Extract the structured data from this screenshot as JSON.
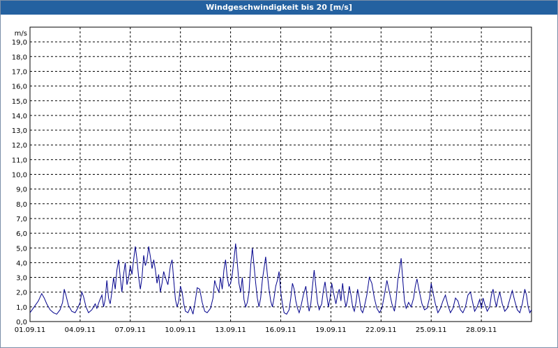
{
  "window": {
    "title": "Windgeschwindigkeit bis 20 [m/s]"
  },
  "chart_data": {
    "type": "line",
    "title": "Windgeschwindigkeit bis 20 [m/s]",
    "ylabel": "m/s",
    "xlabel": "",
    "ylim": [
      0,
      20
    ],
    "xlim": [
      "01.09.11",
      "01.10.11"
    ],
    "grid": true,
    "colors": {
      "line": "#00008b",
      "grid": "#000000",
      "frame": "#000000",
      "titlebar": "#2461a0"
    },
    "y_ticks": [
      "0,0",
      "1,0",
      "2,0",
      "3,0",
      "4,0",
      "5,0",
      "6,0",
      "7,0",
      "8,0",
      "9,0",
      "10,0",
      "11,0",
      "12,0",
      "13,0",
      "14,0",
      "15,0",
      "16,0",
      "17,0",
      "18,0",
      "19,0"
    ],
    "x_ticks": [
      "01.09.11",
      "04.09.11",
      "07.09.11",
      "10.09.11",
      "13.09.11",
      "16.09.11",
      "19.09.11",
      "22.09.11",
      "25.09.11",
      "28.09.11"
    ],
    "series": [
      {
        "values": [
          [
            0.0,
            0.6
          ],
          [
            0.25,
            1.0
          ],
          [
            0.5,
            1.4
          ],
          [
            0.7,
            1.9
          ],
          [
            0.85,
            1.6
          ],
          [
            1.0,
            1.2
          ],
          [
            1.2,
            0.8
          ],
          [
            1.4,
            0.6
          ],
          [
            1.6,
            0.5
          ],
          [
            1.8,
            0.8
          ],
          [
            1.95,
            1.3
          ],
          [
            2.05,
            2.2
          ],
          [
            2.15,
            1.8
          ],
          [
            2.3,
            1.1
          ],
          [
            2.5,
            0.7
          ],
          [
            2.7,
            0.6
          ],
          [
            2.85,
            0.9
          ],
          [
            3.0,
            1.3
          ],
          [
            3.1,
            2.0
          ],
          [
            3.2,
            1.7
          ],
          [
            3.35,
            1.0
          ],
          [
            3.5,
            0.6
          ],
          [
            3.7,
            0.8
          ],
          [
            3.9,
            1.2
          ],
          [
            4.0,
            0.9
          ],
          [
            4.15,
            1.4
          ],
          [
            4.3,
            1.8
          ],
          [
            4.4,
            1.0
          ],
          [
            4.5,
            1.5
          ],
          [
            4.6,
            2.8
          ],
          [
            4.7,
            1.6
          ],
          [
            4.8,
            1.2
          ],
          [
            4.9,
            2.0
          ],
          [
            5.0,
            3.0
          ],
          [
            5.1,
            2.2
          ],
          [
            5.2,
            3.5
          ],
          [
            5.3,
            4.2
          ],
          [
            5.4,
            3.0
          ],
          [
            5.5,
            2.0
          ],
          [
            5.6,
            3.2
          ],
          [
            5.7,
            4.0
          ],
          [
            5.8,
            2.5
          ],
          [
            5.9,
            3.0
          ],
          [
            6.0,
            3.8
          ],
          [
            6.1,
            3.2
          ],
          [
            6.2,
            4.2
          ],
          [
            6.3,
            5.1
          ],
          [
            6.4,
            4.2
          ],
          [
            6.5,
            3.0
          ],
          [
            6.6,
            2.2
          ],
          [
            6.7,
            3.0
          ],
          [
            6.8,
            4.5
          ],
          [
            6.9,
            3.8
          ],
          [
            7.0,
            4.2
          ],
          [
            7.1,
            5.1
          ],
          [
            7.2,
            4.4
          ],
          [
            7.3,
            3.6
          ],
          [
            7.4,
            4.2
          ],
          [
            7.5,
            3.5
          ],
          [
            7.6,
            2.6
          ],
          [
            7.7,
            3.2
          ],
          [
            7.8,
            2.0
          ],
          [
            7.9,
            2.6
          ],
          [
            8.0,
            3.4
          ],
          [
            8.1,
            3.0
          ],
          [
            8.25,
            2.5
          ],
          [
            8.4,
            3.8
          ],
          [
            8.5,
            4.2
          ],
          [
            8.6,
            2.8
          ],
          [
            8.7,
            1.5
          ],
          [
            8.8,
            1.0
          ],
          [
            8.9,
            1.4
          ],
          [
            9.0,
            2.4
          ],
          [
            9.1,
            2.0
          ],
          [
            9.2,
            1.2
          ],
          [
            9.3,
            0.7
          ],
          [
            9.45,
            0.6
          ],
          [
            9.6,
            1.0
          ],
          [
            9.75,
            0.5
          ],
          [
            9.9,
            1.5
          ],
          [
            10.0,
            2.3
          ],
          [
            10.15,
            2.2
          ],
          [
            10.3,
            1.3
          ],
          [
            10.45,
            0.7
          ],
          [
            10.6,
            0.6
          ],
          [
            10.8,
            0.9
          ],
          [
            10.95,
            1.6
          ],
          [
            11.05,
            2.8
          ],
          [
            11.15,
            2.4
          ],
          [
            11.3,
            2.0
          ],
          [
            11.4,
            3.0
          ],
          [
            11.5,
            2.2
          ],
          [
            11.6,
            3.5
          ],
          [
            11.7,
            4.2
          ],
          [
            11.8,
            3.0
          ],
          [
            11.9,
            2.4
          ],
          [
            12.0,
            2.6
          ],
          [
            12.1,
            3.2
          ],
          [
            12.2,
            4.2
          ],
          [
            12.3,
            5.3
          ],
          [
            12.4,
            4.0
          ],
          [
            12.5,
            2.6
          ],
          [
            12.6,
            2.0
          ],
          [
            12.7,
            3.0
          ],
          [
            12.8,
            1.5
          ],
          [
            12.9,
            1.0
          ],
          [
            13.0,
            1.3
          ],
          [
            13.1,
            2.0
          ],
          [
            13.2,
            3.8
          ],
          [
            13.3,
            5.0
          ],
          [
            13.4,
            3.8
          ],
          [
            13.5,
            2.6
          ],
          [
            13.6,
            1.6
          ],
          [
            13.7,
            1.0
          ],
          [
            13.8,
            1.6
          ],
          [
            13.9,
            2.8
          ],
          [
            14.0,
            3.6
          ],
          [
            14.1,
            4.4
          ],
          [
            14.2,
            3.2
          ],
          [
            14.3,
            2.2
          ],
          [
            14.4,
            1.4
          ],
          [
            14.5,
            1.0
          ],
          [
            14.6,
            1.6
          ],
          [
            14.7,
            2.4
          ],
          [
            14.8,
            2.8
          ],
          [
            14.9,
            3.4
          ],
          [
            15.0,
            2.0
          ],
          [
            15.1,
            1.2
          ],
          [
            15.2,
            0.6
          ],
          [
            15.35,
            0.5
          ],
          [
            15.5,
            0.8
          ],
          [
            15.6,
            1.6
          ],
          [
            15.7,
            2.6
          ],
          [
            15.8,
            2.2
          ],
          [
            15.9,
            1.4
          ],
          [
            16.0,
            0.9
          ],
          [
            16.1,
            0.6
          ],
          [
            16.2,
            1.0
          ],
          [
            16.35,
            1.8
          ],
          [
            16.5,
            2.4
          ],
          [
            16.6,
            1.4
          ],
          [
            16.7,
            0.7
          ],
          [
            16.8,
            1.2
          ],
          [
            16.9,
            2.4
          ],
          [
            17.0,
            3.5
          ],
          [
            17.1,
            2.4
          ],
          [
            17.2,
            1.3
          ],
          [
            17.3,
            0.8
          ],
          [
            17.45,
            1.2
          ],
          [
            17.55,
            2.1
          ],
          [
            17.65,
            2.7
          ],
          [
            17.75,
            1.8
          ],
          [
            17.85,
            1.0
          ],
          [
            17.95,
            1.6
          ],
          [
            18.05,
            2.6
          ],
          [
            18.15,
            2.0
          ],
          [
            18.3,
            1.2
          ],
          [
            18.4,
            1.8
          ],
          [
            18.5,
            2.2
          ],
          [
            18.6,
            1.4
          ],
          [
            18.7,
            2.6
          ],
          [
            18.8,
            1.6
          ],
          [
            18.9,
            1.0
          ],
          [
            19.0,
            1.5
          ],
          [
            19.1,
            2.4
          ],
          [
            19.2,
            1.8
          ],
          [
            19.3,
            1.0
          ],
          [
            19.4,
            0.7
          ],
          [
            19.5,
            1.3
          ],
          [
            19.6,
            2.2
          ],
          [
            19.7,
            1.6
          ],
          [
            19.8,
            0.8
          ],
          [
            19.9,
            0.6
          ],
          [
            20.0,
            1.0
          ],
          [
            20.15,
            1.8
          ],
          [
            20.3,
            3.0
          ],
          [
            20.45,
            2.6
          ],
          [
            20.6,
            1.6
          ],
          [
            20.75,
            0.9
          ],
          [
            20.9,
            0.6
          ],
          [
            21.05,
            0.9
          ],
          [
            21.2,
            1.8
          ],
          [
            21.35,
            2.8
          ],
          [
            21.5,
            2.0
          ],
          [
            21.65,
            1.2
          ],
          [
            21.8,
            0.7
          ],
          [
            21.9,
            1.5
          ],
          [
            22.0,
            2.8
          ],
          [
            22.1,
            3.5
          ],
          [
            22.2,
            4.3
          ],
          [
            22.3,
            2.8
          ],
          [
            22.4,
            1.4
          ],
          [
            22.5,
            0.9
          ],
          [
            22.65,
            1.3
          ],
          [
            22.8,
            1.0
          ],
          [
            22.95,
            1.6
          ],
          [
            23.05,
            2.4
          ],
          [
            23.15,
            2.9
          ],
          [
            23.3,
            2.0
          ],
          [
            23.45,
            1.2
          ],
          [
            23.6,
            0.8
          ],
          [
            23.75,
            0.9
          ],
          [
            23.9,
            1.6
          ],
          [
            24.0,
            2.6
          ],
          [
            24.1,
            2.0
          ],
          [
            24.25,
            1.2
          ],
          [
            24.4,
            0.6
          ],
          [
            24.55,
            0.9
          ],
          [
            24.7,
            1.4
          ],
          [
            24.85,
            1.8
          ],
          [
            25.0,
            1.1
          ],
          [
            25.15,
            0.6
          ],
          [
            25.3,
            0.9
          ],
          [
            25.45,
            1.6
          ],
          [
            25.6,
            1.4
          ],
          [
            25.75,
            0.8
          ],
          [
            25.9,
            0.6
          ],
          [
            26.05,
            1.0
          ],
          [
            26.2,
            1.8
          ],
          [
            26.35,
            2.0
          ],
          [
            26.5,
            1.2
          ],
          [
            26.6,
            0.7
          ],
          [
            26.75,
            1.0
          ],
          [
            26.9,
            1.5
          ],
          [
            27.0,
            0.9
          ],
          [
            27.1,
            1.6
          ],
          [
            27.2,
            1.2
          ],
          [
            27.35,
            0.7
          ],
          [
            27.5,
            1.0
          ],
          [
            27.6,
            1.8
          ],
          [
            27.7,
            2.2
          ],
          [
            27.8,
            1.5
          ],
          [
            27.9,
            1.0
          ],
          [
            28.0,
            1.6
          ],
          [
            28.1,
            2.0
          ],
          [
            28.25,
            1.2
          ],
          [
            28.4,
            0.7
          ],
          [
            28.55,
            0.9
          ],
          [
            28.7,
            1.5
          ],
          [
            28.85,
            2.1
          ],
          [
            29.0,
            1.4
          ],
          [
            29.15,
            0.8
          ],
          [
            29.3,
            0.6
          ],
          [
            29.45,
            1.2
          ],
          [
            29.6,
            2.2
          ],
          [
            29.7,
            1.8
          ],
          [
            29.8,
            1.0
          ],
          [
            29.9,
            0.6
          ],
          [
            30.0,
            0.8
          ]
        ]
      }
    ]
  }
}
